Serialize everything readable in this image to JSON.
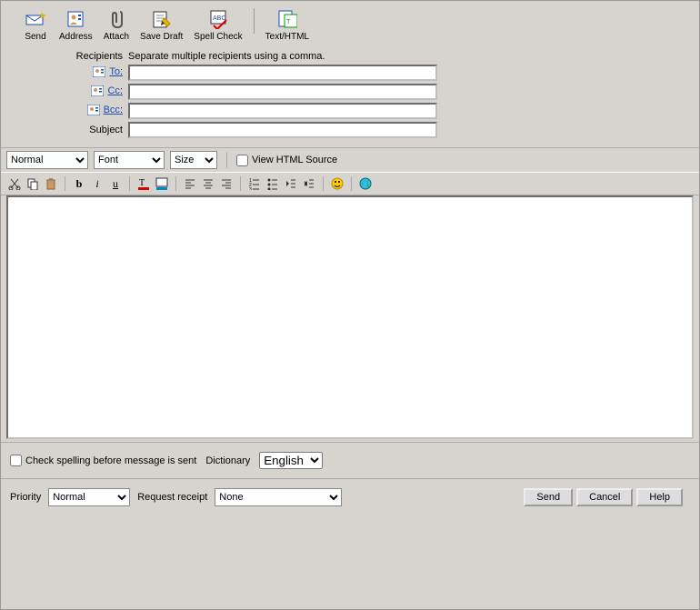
{
  "toolbar": {
    "send": "Send",
    "address": "Address",
    "attach": "Attach",
    "save_draft": "Save Draft",
    "spell_check": "Spell Check",
    "text_html": "Text/HTML"
  },
  "recipients": {
    "header": "Recipients",
    "hint": "Separate multiple recipients using a comma.",
    "to_label": "To",
    "cc_label": "Cc",
    "bcc_label": "Bcc",
    "subject_label": "Subject",
    "to_value": "",
    "cc_value": "",
    "bcc_value": "",
    "subject_value": ""
  },
  "format": {
    "style_options": [
      "Normal"
    ],
    "style_selected": "Normal",
    "font_options": [
      "Font"
    ],
    "font_selected": "Font",
    "size_options": [
      "Size"
    ],
    "size_selected": "Size",
    "view_source_label": "View HTML Source",
    "view_source_checked": false
  },
  "editbar": {
    "cut": "cut",
    "copy": "copy",
    "paste": "paste",
    "bold": "b",
    "italic": "i",
    "underline": "u",
    "fgcolor": "A",
    "bgcolor": "A",
    "align_left": "left",
    "align_center": "center",
    "align_right": "right",
    "ol": "ol",
    "ul": "ul",
    "outdent": "outdent",
    "indent": "indent",
    "emoji": "emoji",
    "link": "link"
  },
  "body_value": "",
  "options": {
    "spellcheck_label": "Check spelling before message is sent",
    "spellcheck_checked": false,
    "dictionary_label": "Dictionary",
    "dictionary_options": [
      "English"
    ],
    "dictionary_selected": "English"
  },
  "bottom": {
    "priority_label": "Priority",
    "priority_options": [
      "Normal"
    ],
    "priority_selected": "Normal",
    "receipt_label": "Request receipt",
    "receipt_options": [
      "None"
    ],
    "receipt_selected": "None",
    "send_btn": "Send",
    "cancel_btn": "Cancel",
    "help_btn": "Help"
  }
}
